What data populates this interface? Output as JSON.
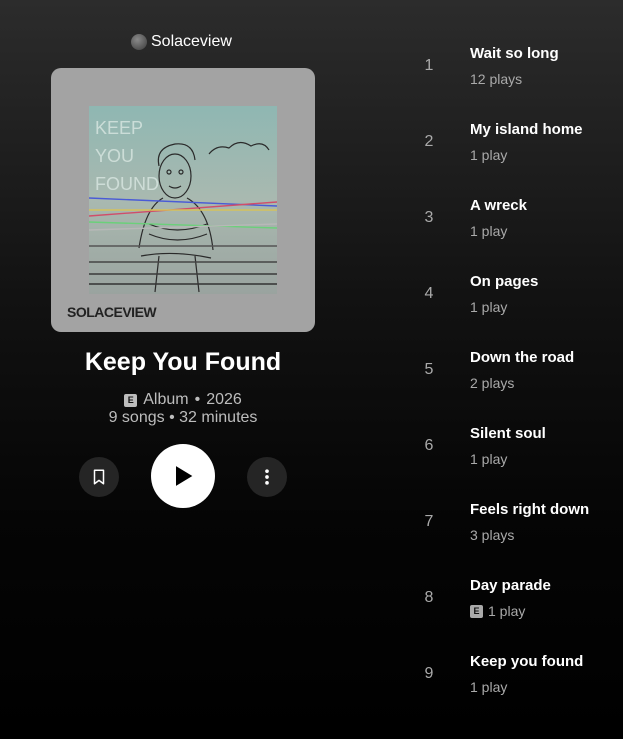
{
  "artist": {
    "name": "Solaceview"
  },
  "album": {
    "title": "Keep You Found",
    "art_title_text": "KEEP YOU FOUND",
    "art_label": "SOLACEVIEW",
    "type": "Album",
    "year": "2026",
    "explicit_badge": "E",
    "separator": "•",
    "songs": "9 songs",
    "duration": "32 minutes"
  },
  "actions": {
    "save_icon": "bookmark-icon",
    "play_icon": "play-icon",
    "more_icon": "more-vertical-icon"
  },
  "tracks": [
    {
      "number": "1",
      "title": "Wait so long",
      "plays": "12 plays",
      "explicit": false
    },
    {
      "number": "2",
      "title": "My island home",
      "plays": "1 play",
      "explicit": false
    },
    {
      "number": "3",
      "title": "A wreck",
      "plays": "1 play",
      "explicit": false
    },
    {
      "number": "4",
      "title": "On pages",
      "plays": "1 play",
      "explicit": false
    },
    {
      "number": "5",
      "title": "Down the road",
      "plays": "2 plays",
      "explicit": false
    },
    {
      "number": "6",
      "title": "Silent soul",
      "plays": "1 play",
      "explicit": false
    },
    {
      "number": "7",
      "title": "Feels right down",
      "plays": "3 plays",
      "explicit": false
    },
    {
      "number": "8",
      "title": "Day parade",
      "plays": "1 play",
      "explicit": true
    },
    {
      "number": "9",
      "title": "Keep you found",
      "plays": "1 play",
      "explicit": false
    }
  ],
  "colors": {
    "background_top": "#2c2c2c",
    "background_bottom": "#000000",
    "text_primary": "#ffffff",
    "text_secondary": "#aaaaaa",
    "button_bg": "#252525",
    "play_button_bg": "#ffffff",
    "album_card_bg": "#a3a3a3"
  }
}
